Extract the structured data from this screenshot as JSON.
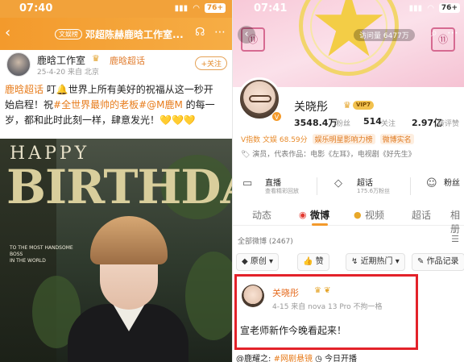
{
  "left": {
    "status": {
      "time": "07:40",
      "battery": "76+"
    },
    "header": {
      "tag": "文娱榜",
      "title": "邓超陈赫鹿晗工作室..."
    },
    "account": {
      "name": "鹿晗工作室",
      "supertopic": "鹿晗超话",
      "meta": "25-4-20 来自 北京",
      "follow_label": "+关注"
    },
    "post": {
      "line1_link": "鹿晗超话",
      "line1_text": " 叮🔔世界上所有美好的祝福从这一秒开",
      "line2_text": "始启程！祝",
      "line2_link": "#全世界最帅的老板#@M鹿M",
      "line2_tail": " 的每一",
      "line3_text": "岁，都和此时此刻一样，肆意发光！💛💛💛"
    },
    "photo": {
      "happy": "HAPPY",
      "birthday": "BIRTHDAY",
      "sub1": "TO THE MOST HANDSOME BOSS",
      "sub2": "IN THE WORLD"
    }
  },
  "right": {
    "status": {
      "time": "07:41",
      "battery": "76+"
    },
    "cover": {
      "visitors": "访问量 6477万",
      "wing_left": "⑪",
      "wing_right": "⑪"
    },
    "profile": {
      "name": "关晓彤",
      "vip": "VIP7",
      "fans_num": "3548.4万",
      "fans_lbl": "粉丝",
      "follow_num": "514",
      "follow_lbl": "关注",
      "likes_num": "2.97亿",
      "likes_lbl": "转评赞"
    },
    "vrow": {
      "v_index": "V指数 文娱 68.59分",
      "tag1": "娱乐明星影响力榜",
      "tag2": "微博实名"
    },
    "works": "🏷 演员，代表作品：电影《左耳》，电视剧《好先生》",
    "tiles": [
      {
        "title": "直播",
        "sub": "查看精彩回放",
        "icon": "▭"
      },
      {
        "title": "超话",
        "sub": "175.6万粉丝",
        "icon": "◇"
      },
      {
        "title": "粉丝",
        "sub": "",
        "icon": "☺"
      }
    ],
    "tabs": [
      "动态",
      "微博",
      "视频",
      "超话",
      "相册"
    ],
    "all_posts": "全部微博 (2467)",
    "filters": [
      "原创",
      "赞",
      "近期热门",
      "作品记录"
    ],
    "card": {
      "name": "关晓彤",
      "meta": "4-15  来自 nova 13 Pro 不拘一格",
      "text": "宣老师新作今晚看起来！"
    },
    "bottom": {
      "prefix": "@鹿耀之:",
      "link": "#网剧悬镜",
      "tail": " 今日开播"
    }
  }
}
